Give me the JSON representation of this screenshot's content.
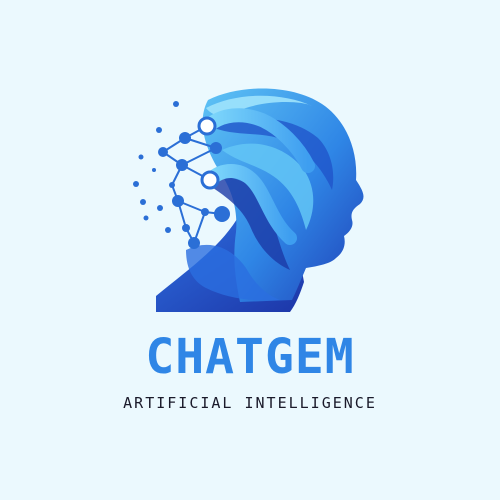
{
  "background_color": "#ebf9fe",
  "logo": {
    "icon": "ai-head-network-icon",
    "brand_name": "CHATGEM",
    "tagline": "ARTIFICIAL INTELLIGENCE",
    "colors": {
      "brand_text": "#2f86e6",
      "tagline_text": "#1a1a2a",
      "head_light": "#53b6f2",
      "head_mid": "#2f7fe0",
      "head_dark": "#1f3fb6",
      "node": "#2b6fd6"
    }
  }
}
